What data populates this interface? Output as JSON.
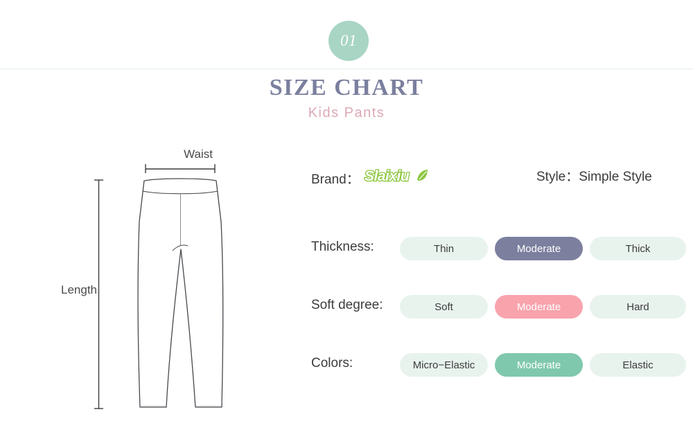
{
  "header": {
    "badge_number": "01",
    "title": "SIZE CHART",
    "subtitle": "Kids Pants"
  },
  "illustration": {
    "waist_label": "Waist",
    "length_label": "Length",
    "garment": "kids-pants-line-drawing"
  },
  "meta": {
    "brand_label": "Brand：",
    "brand_name": "Slaixiu",
    "style_text": "Style：Simple Style"
  },
  "options": [
    {
      "label": "Thickness:",
      "choices": [
        {
          "text": "Thin",
          "selected": false
        },
        {
          "text": "Moderate",
          "selected": true
        },
        {
          "text": "Thick",
          "selected": false
        }
      ]
    },
    {
      "label": "Soft degree:",
      "choices": [
        {
          "text": "Soft",
          "selected": false
        },
        {
          "text": "Moderate",
          "selected": true
        },
        {
          "text": "Hard",
          "selected": false
        }
      ]
    },
    {
      "label": "Colors:",
      "choices": [
        {
          "text": "Micro−Elastic",
          "selected": false
        },
        {
          "text": "Moderate",
          "selected": true
        },
        {
          "text": "Elastic",
          "selected": false
        }
      ]
    }
  ],
  "colors": {
    "badge_mint": "#a8d5c4",
    "title_slate": "#7b7f9e",
    "subtitle_pink": "#dba9b4",
    "pill_inactive": "#e8f3ee",
    "pill_slate": "#7c7f9e",
    "pill_pink": "#f9a3ad",
    "pill_green": "#7fc8ad",
    "brand_green": "#8cc63f",
    "divider": "#dfeeea",
    "line_art": "#3c3c3c"
  }
}
